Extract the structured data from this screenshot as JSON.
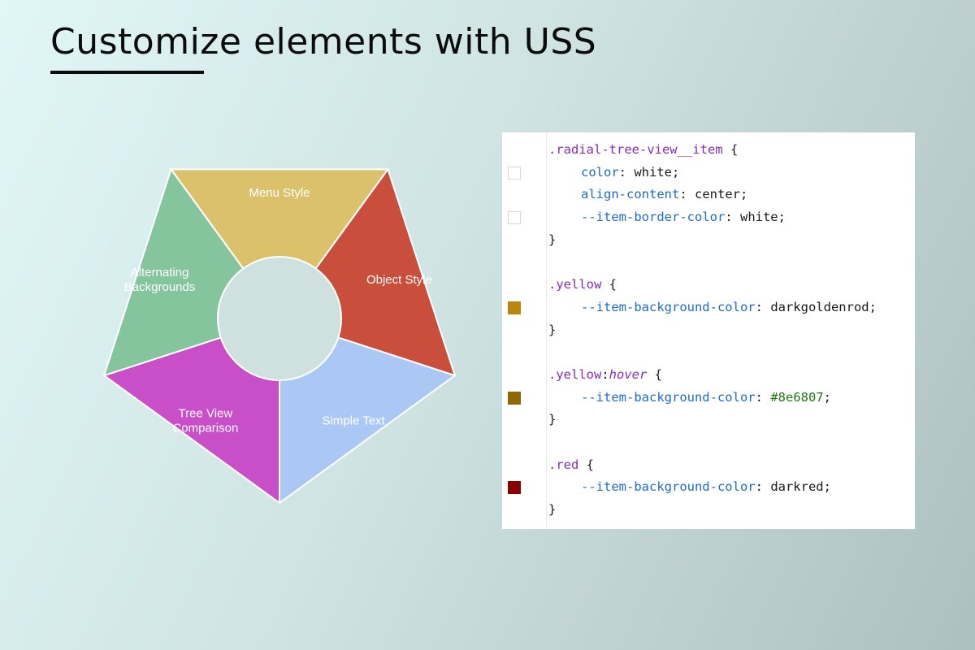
{
  "title": "Customize elements with USS",
  "radial_menu": {
    "segments": [
      {
        "label_lines": [
          "Menu Style"
        ],
        "color": "#dcc16c"
      },
      {
        "label_lines": [
          "Object Style"
        ],
        "color": "#c94e3c"
      },
      {
        "label_lines": [
          "Simple Text"
        ],
        "color": "#abc8f5"
      },
      {
        "label_lines": [
          "Tree View",
          "Comparison"
        ],
        "color": "#c84fc8"
      },
      {
        "label_lines": [
          "Alternating",
          "Backgrounds"
        ],
        "color": "#85c59e"
      }
    ]
  },
  "code": {
    "rules": [
      {
        "selector": ".radial-tree-view__item",
        "declarations": [
          {
            "property": "color",
            "value": "white",
            "swatch": "#ffffff"
          },
          {
            "property": "align-content",
            "value": "center"
          },
          {
            "property": "--item-border-color",
            "value": "white",
            "swatch": "#ffffff"
          }
        ]
      },
      {
        "selector": ".yellow",
        "declarations": [
          {
            "property": "--item-background-color",
            "value": "darkgoldenrod",
            "swatch": "#b8860b"
          }
        ]
      },
      {
        "selector": ".yellow",
        "pseudo": "hover",
        "declarations": [
          {
            "property": "--item-background-color",
            "value": "#8e6807",
            "value_is_hex": true,
            "swatch": "#8e6807"
          }
        ]
      },
      {
        "selector": ".red",
        "declarations": [
          {
            "property": "--item-background-color",
            "value": "darkred",
            "swatch": "#8b0000"
          }
        ]
      }
    ]
  }
}
